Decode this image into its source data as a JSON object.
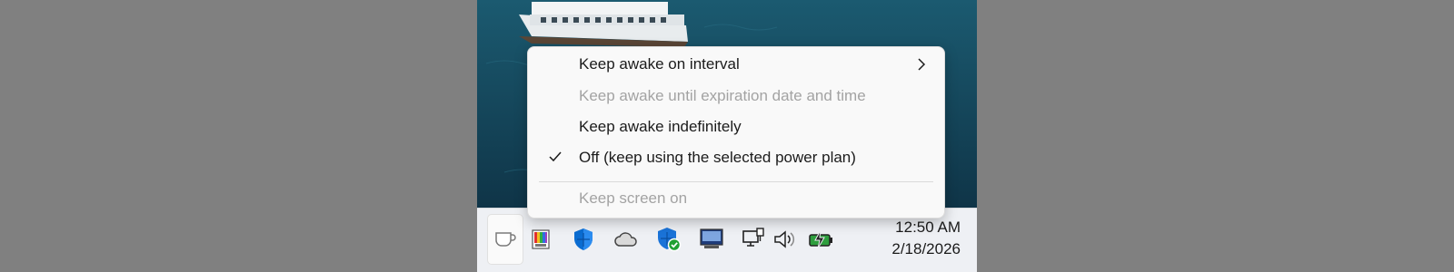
{
  "context_menu": {
    "items": [
      {
        "label": "Keep awake on interval",
        "enabled": true,
        "checked": false,
        "has_submenu": true
      },
      {
        "label": "Keep awake until expiration date and time",
        "enabled": false,
        "checked": false,
        "has_submenu": false
      },
      {
        "label": "Keep awake indefinitely",
        "enabled": true,
        "checked": false,
        "has_submenu": false
      },
      {
        "label": "Off (keep using the selected power plan)",
        "enabled": true,
        "checked": true,
        "has_submenu": false
      },
      {
        "label": "Keep screen on",
        "enabled": false,
        "checked": false,
        "has_submenu": false
      }
    ]
  },
  "taskbar": {
    "tray_icons": [
      "awake-coffee-cup-icon",
      "color-picker-icon",
      "windows-defender-shield-icon",
      "onedrive-cloud-icon",
      "windows-security-icon",
      "display-monitor-icon",
      "network-ethernet-icon",
      "speaker-volume-icon",
      "battery-charging-icon"
    ],
    "clock_time": "12:50 AM",
    "clock_date": "2/18/2026"
  },
  "colors": {
    "menu_bg": "#f9f9f9",
    "disabled_text": "#a3a3a3",
    "taskbar_bg": "#eef0f4",
    "accent_blue": "#0067c0",
    "battery_green": "#2e9e3e"
  }
}
